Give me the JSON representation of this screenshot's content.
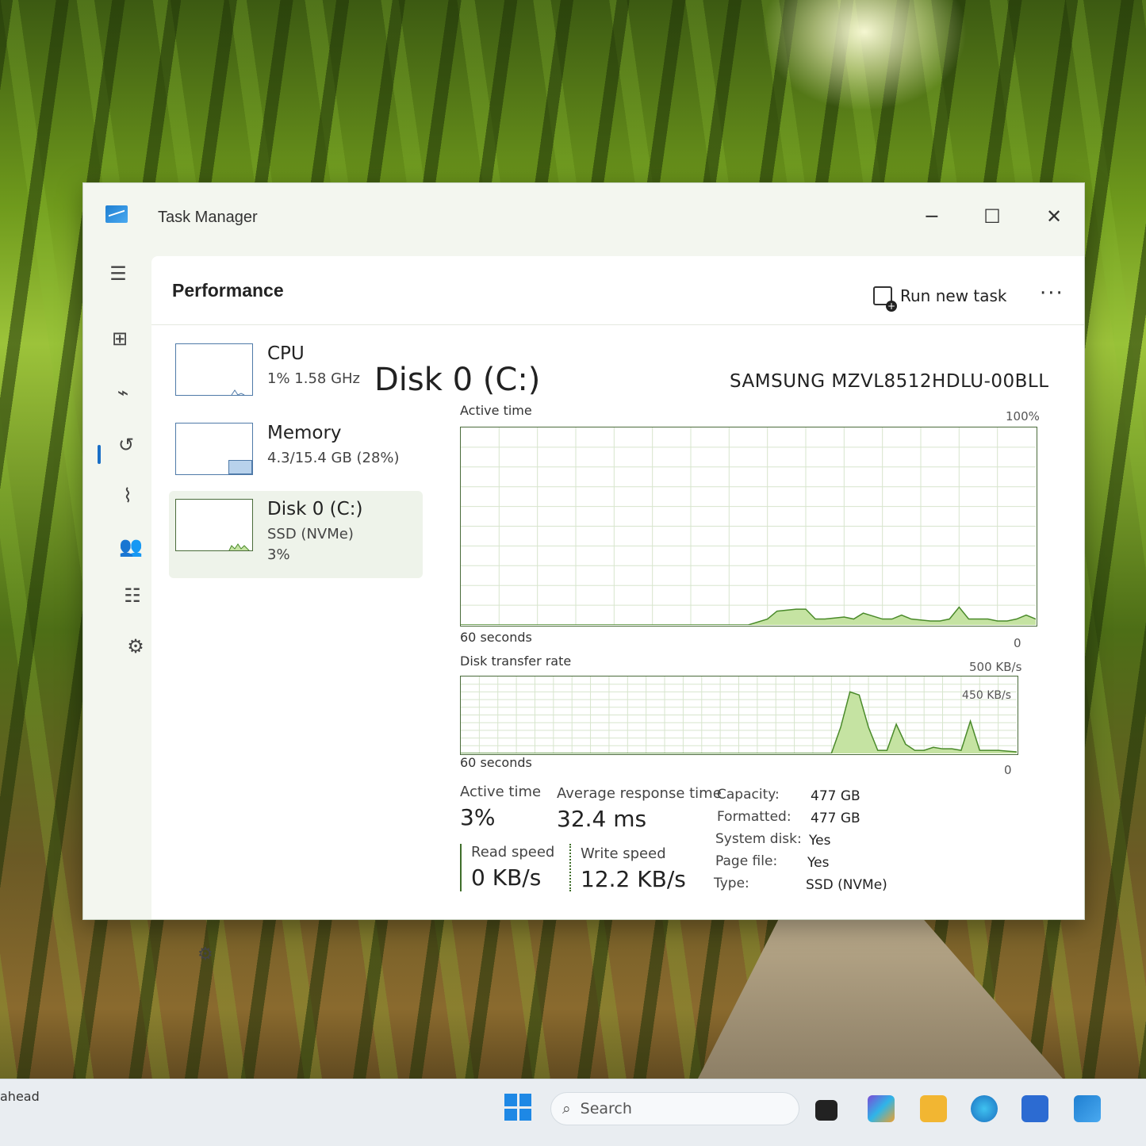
{
  "window": {
    "title": "Task Manager",
    "minimize_glyph": "─",
    "maximize_glyph": "☐",
    "close_glyph": "✕"
  },
  "nav": {
    "items": [
      {
        "icon": "hamburger-menu-icon",
        "glyph": "☰"
      },
      {
        "icon": "processes-icon",
        "glyph": "⊞"
      },
      {
        "icon": "performance-icon",
        "glyph": "⌁"
      },
      {
        "icon": "app-history-icon",
        "glyph": "↺"
      },
      {
        "icon": "startup-apps-icon",
        "glyph": "⌇"
      },
      {
        "icon": "users-icon",
        "glyph": "👥"
      },
      {
        "icon": "details-icon",
        "glyph": "☷"
      },
      {
        "icon": "services-icon",
        "glyph": "⚙"
      }
    ],
    "settings_glyph": "⚙"
  },
  "header": {
    "title": "Performance",
    "run_new_task": "Run new task",
    "more": "···"
  },
  "resources": [
    {
      "name": "CPU",
      "line1": "1%  1.58 GHz",
      "line2": ""
    },
    {
      "name": "Memory",
      "line1": "4.3/15.4 GB (28%)",
      "line2": ""
    },
    {
      "name": "Disk 0 (C:)",
      "line1": "SSD (NVMe)",
      "line2": "3%"
    }
  ],
  "disk": {
    "title": "Disk 0 (C:)",
    "model": "SAMSUNG MZVL8512HDLU-00BLL",
    "active_chart": {
      "label": "Active time",
      "max": "100%",
      "time_span": "60 seconds",
      "min": "0"
    },
    "transfer_chart": {
      "label": "Disk transfer rate",
      "max": "500 KB/s",
      "inner_label": "450 KB/s",
      "time_span": "60 seconds",
      "min": "0"
    },
    "stats": {
      "active_time_label": "Active time",
      "active_time_value": "3%",
      "avg_response_label": "Average response time",
      "avg_response_value": "32.4 ms",
      "read_speed_label": "Read speed",
      "read_speed_value": "0 KB/s",
      "write_speed_label": "Write speed",
      "write_speed_value": "12.2 KB/s"
    },
    "properties": [
      {
        "label": "Capacity:",
        "value": "477 GB"
      },
      {
        "label": "Formatted:",
        "value": "477 GB"
      },
      {
        "label": "System disk:",
        "value": "Yes"
      },
      {
        "label": "Page file:",
        "value": "Yes"
      },
      {
        "label": "Type:",
        "value": "SSD (NVMe)"
      }
    ]
  },
  "chart_data": [
    {
      "type": "area",
      "title": "Active time",
      "ylim": [
        0,
        100
      ],
      "x": [
        0,
        30,
        32,
        33,
        35,
        36,
        37,
        38,
        40,
        41,
        42,
        44,
        45,
        46,
        47,
        49,
        50,
        51,
        52,
        53,
        55,
        56,
        57,
        58,
        59,
        60
      ],
      "series": [
        {
          "values": [
            0,
            0,
            3,
            7,
            8,
            8,
            3,
            3,
            4,
            3,
            6,
            3,
            3,
            5,
            3,
            2,
            2,
            3,
            9,
            3,
            3,
            2,
            2,
            3,
            5,
            3
          ]
        }
      ]
    },
    {
      "type": "area",
      "title": "Disk transfer rate",
      "ylim": [
        0,
        500
      ],
      "x": [
        0,
        40,
        41,
        42,
        43,
        44,
        45,
        46,
        47,
        48,
        49,
        50,
        51,
        52,
        53,
        54,
        55,
        56,
        57,
        58,
        59,
        60
      ],
      "series": [
        {
          "values": [
            0,
            0,
            170,
            400,
            380,
            170,
            20,
            20,
            190,
            60,
            20,
            20,
            40,
            30,
            30,
            20,
            210,
            20,
            20,
            20,
            15,
            10
          ]
        }
      ]
    }
  ],
  "taskbar": {
    "left_text": "ahead",
    "search_placeholder": "Search",
    "apps": [
      "file-explorer-dark-icon",
      "copilot-icon",
      "folder-icon",
      "edge-icon",
      "store-icon",
      "task-manager-icon"
    ]
  },
  "colors": {
    "accent": "#1a6fc6",
    "disk_line": "#4a8a2a",
    "disk_fill": "#c5e3a2",
    "grid": "#d7e5cd"
  }
}
